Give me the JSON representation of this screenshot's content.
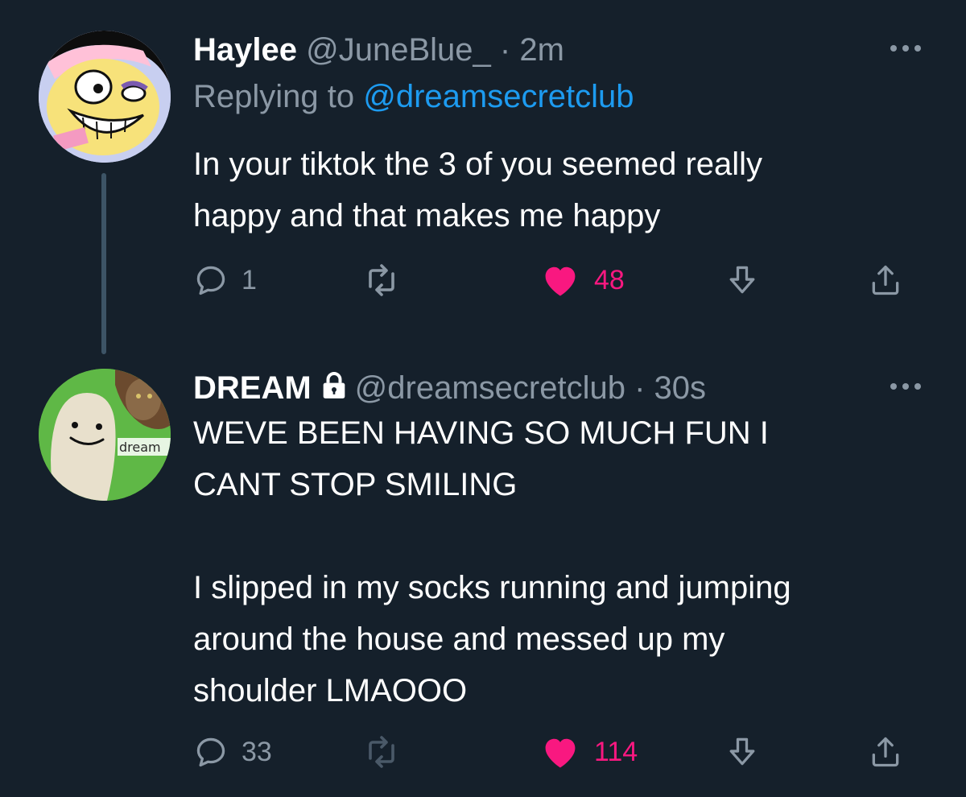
{
  "tweets": [
    {
      "display_name": "Haylee",
      "handle": "@JuneBlue_",
      "separator": "·",
      "time": "2m",
      "replying_prefix": "Replying to ",
      "replying_to": "@dreamsecretclub",
      "body": "In your tiktok the 3 of you seemed really\nhappy and that makes me happy",
      "reply_count": "1",
      "like_count": "48",
      "liked": true,
      "avatar_icon": "cartoon-character-avatar"
    },
    {
      "display_name": "DREAM",
      "protected": true,
      "handle": "@dreamsecretclub",
      "separator": "·",
      "time": "30s",
      "body_line1": "WEVE BEEN HAVING SO MUCH FUN I\nCANT STOP SMILING",
      "body_line2": "I slipped in my socks running and jumping\naround the house and messed up my\nshoulder LMAOOO",
      "reply_count": "33",
      "like_count": "114",
      "liked": true,
      "avatar_icon": "smiley-blob-avatar",
      "avatar_label": "dream"
    }
  ],
  "colors": {
    "background": "#15202b",
    "text_primary": "#ffffff",
    "text_secondary": "#8b98a5",
    "link": "#1d9bf0",
    "like": "#f91880"
  }
}
